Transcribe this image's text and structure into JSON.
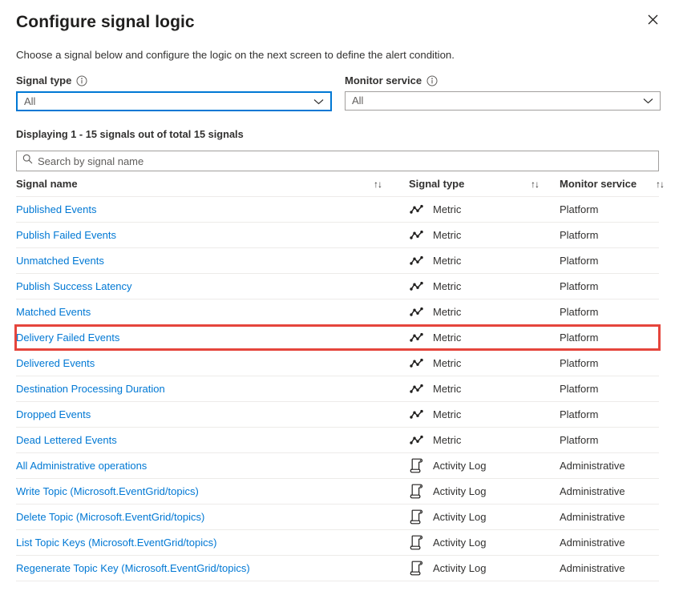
{
  "header": {
    "title": "Configure signal logic",
    "close_icon": "close-icon"
  },
  "description": "Choose a signal below and configure the logic on the next screen to define the alert condition.",
  "filters": [
    {
      "label": "Signal type",
      "info_icon": "info-icon",
      "value": "All",
      "chevron_icon": "chevron-down-icon",
      "focused": true
    },
    {
      "label": "Monitor service",
      "info_icon": "info-icon",
      "value": "All",
      "chevron_icon": "chevron-down-icon",
      "focused": false
    }
  ],
  "count_line": "Displaying 1 - 15 signals out of total 15 signals",
  "search": {
    "placeholder": "Search by signal name",
    "value": "",
    "icon": "search-icon"
  },
  "table": {
    "columns": [
      {
        "label": "Signal name",
        "sort_glyph": "↑↓"
      },
      {
        "label": "Signal type",
        "sort_glyph": "↑↓"
      },
      {
        "label": "Monitor service",
        "sort_glyph": "↑↓"
      }
    ],
    "rows": [
      {
        "name": "Published Events",
        "type": "Metric",
        "type_icon": "metric-line-chart-icon",
        "monitor": "Platform",
        "highlighted": false
      },
      {
        "name": "Publish Failed Events",
        "type": "Metric",
        "type_icon": "metric-line-chart-icon",
        "monitor": "Platform",
        "highlighted": false
      },
      {
        "name": "Unmatched Events",
        "type": "Metric",
        "type_icon": "metric-line-chart-icon",
        "monitor": "Platform",
        "highlighted": false
      },
      {
        "name": "Publish Success Latency",
        "type": "Metric",
        "type_icon": "metric-line-chart-icon",
        "monitor": "Platform",
        "highlighted": false
      },
      {
        "name": "Matched Events",
        "type": "Metric",
        "type_icon": "metric-line-chart-icon",
        "monitor": "Platform",
        "highlighted": false
      },
      {
        "name": "Delivery Failed Events",
        "type": "Metric",
        "type_icon": "metric-line-chart-icon",
        "monitor": "Platform",
        "highlighted": true
      },
      {
        "name": "Delivered Events",
        "type": "Metric",
        "type_icon": "metric-line-chart-icon",
        "monitor": "Platform",
        "highlighted": false
      },
      {
        "name": "Destination Processing Duration",
        "type": "Metric",
        "type_icon": "metric-line-chart-icon",
        "monitor": "Platform",
        "highlighted": false
      },
      {
        "name": "Dropped Events",
        "type": "Metric",
        "type_icon": "metric-line-chart-icon",
        "monitor": "Platform",
        "highlighted": false
      },
      {
        "name": "Dead Lettered Events",
        "type": "Metric",
        "type_icon": "metric-line-chart-icon",
        "monitor": "Platform",
        "highlighted": false
      },
      {
        "name": "All Administrative operations",
        "type": "Activity Log",
        "type_icon": "activity-log-scroll-icon",
        "monitor": "Administrative",
        "highlighted": false
      },
      {
        "name": "Write Topic (Microsoft.EventGrid/topics)",
        "type": "Activity Log",
        "type_icon": "activity-log-scroll-icon",
        "monitor": "Administrative",
        "highlighted": false
      },
      {
        "name": "Delete Topic (Microsoft.EventGrid/topics)",
        "type": "Activity Log",
        "type_icon": "activity-log-scroll-icon",
        "monitor": "Administrative",
        "highlighted": false
      },
      {
        "name": "List Topic Keys (Microsoft.EventGrid/topics)",
        "type": "Activity Log",
        "type_icon": "activity-log-scroll-icon",
        "monitor": "Administrative",
        "highlighted": false
      },
      {
        "name": "Regenerate Topic Key (Microsoft.EventGrid/topics)",
        "type": "Activity Log",
        "type_icon": "activity-log-scroll-icon",
        "monitor": "Administrative",
        "highlighted": false
      }
    ]
  },
  "colors": {
    "link": "#0078d4",
    "accent": "#0078d4",
    "highlight_border": "#e5453c",
    "text": "#323130",
    "divider": "#edebe9",
    "control_border": "#a19f9d"
  }
}
